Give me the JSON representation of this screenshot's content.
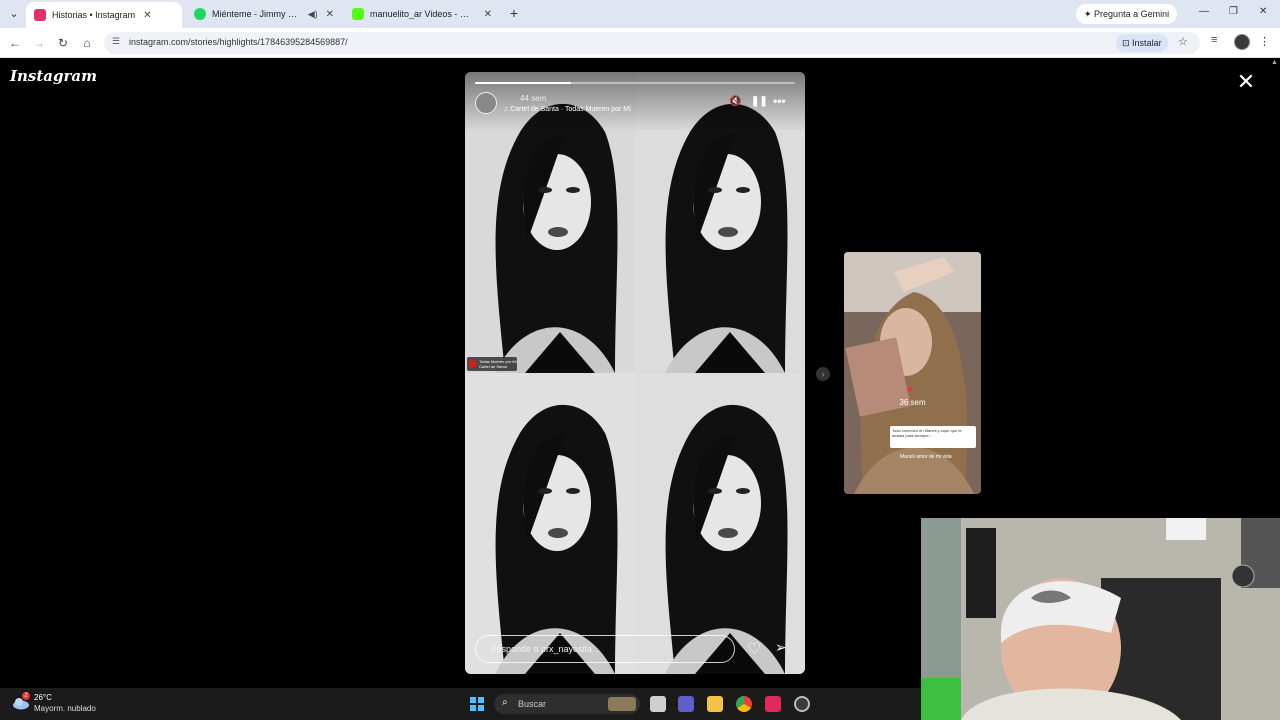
{
  "browser": {
    "tabs": [
      {
        "title": "Historias • Instagram",
        "active": true,
        "favicon_color": "#e1306c"
      },
      {
        "title": "Miénteme - Jimmy Guzman",
        "active": false,
        "favicon_color": "#1ed760"
      },
      {
        "title": "manuelito_ar Videos - Watch O",
        "active": false,
        "favicon_color": "#53fc18"
      }
    ],
    "gemini_label": "Pregunta a Gemini",
    "url": "instagram.com/stories/highlights/17846395284569887/",
    "install_label": "Instalar"
  },
  "instagram": {
    "logo": "Instagram",
    "story": {
      "time": "44 sem",
      "music": "Cartel de Santa · Todas Mueren por Mí",
      "reply_placeholder": "Responde a prx_nayesita...",
      "progress": 0.3,
      "sticker_title": "Todas Mueren por Mí",
      "sticker_artist": "Cartel de Santa"
    },
    "next_preview": {
      "time": "36 sem",
      "note_text": "Todo comenzó en Maneli y supe que te amaba para siempre...",
      "caption": "Maneli amor de mi vida"
    }
  },
  "taskbar": {
    "temperature": "26°C",
    "weather": "Mayorm. nublado",
    "weather_badge": "2",
    "search_label": "Buscar"
  },
  "colors": {
    "ig_bg": "#000000",
    "chrome_tabbar": "#dfe6f1",
    "taskbar": "#1b1b1b"
  }
}
